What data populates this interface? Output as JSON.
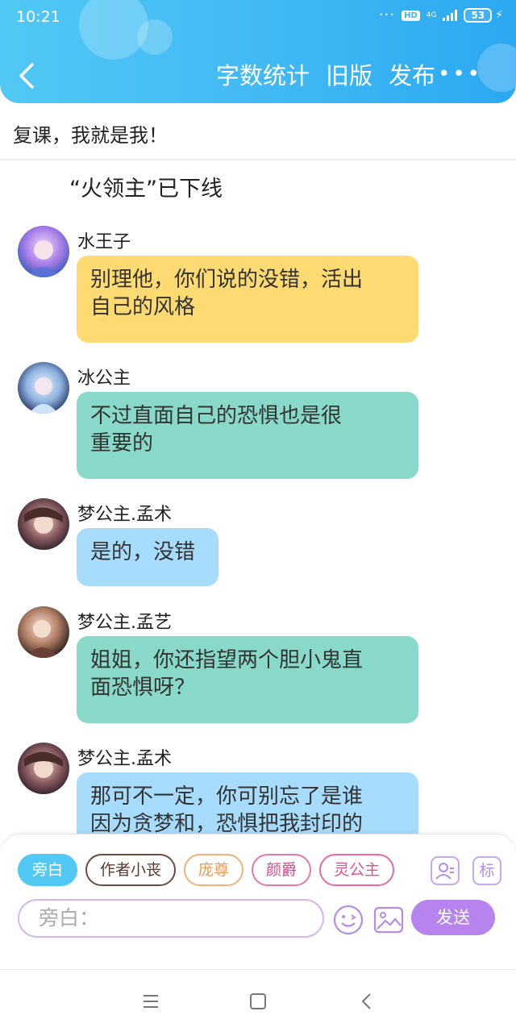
{
  "status_bar": {
    "time": "10:21",
    "hd": "HD",
    "network": "4G",
    "battery": "53"
  },
  "header": {
    "actions": [
      "字数统计",
      "旧版",
      "发布"
    ],
    "more": "•••"
  },
  "document": {
    "title": "复课，我就是我！"
  },
  "narration": "“火领主”已下线",
  "messages": [
    {
      "sender": "水王子",
      "text_lines": [
        "别理他，你们说的没错，活出",
        "自己的风格"
      ],
      "color": "yellow"
    },
    {
      "sender": "冰公主",
      "text_lines": [
        "不过直面自己的恐惧也是很",
        "重要的"
      ],
      "color": "teal"
    },
    {
      "sender": "梦公主.孟术",
      "text_lines": [
        "是的，没错"
      ],
      "color": "blue"
    },
    {
      "sender": "梦公主.孟艺",
      "text_lines": [
        "姐姐，你还指望两个胆小鬼直",
        "面恐惧呀？"
      ],
      "color": "teal"
    },
    {
      "sender": "梦公主.孟术",
      "text_lines": [
        "那可不一定，你可别忘了是谁",
        "因为贪梦和，恐惧把我封印的"
      ],
      "color": "blue"
    }
  ],
  "compose": {
    "roles": [
      "旁白",
      "作者小丧",
      "庞尊",
      "颜爵",
      "灵公主"
    ],
    "role_button": "👤",
    "tag_button": "标",
    "input_placeholder": "旁白：",
    "send_label": "发送"
  },
  "colors": {
    "header": "#3eb6f3",
    "bubble_yellow": "#fdda72",
    "bubble_teal": "#89d9cb",
    "bubble_blue": "#a7dcfc",
    "send": "#b783ec"
  }
}
